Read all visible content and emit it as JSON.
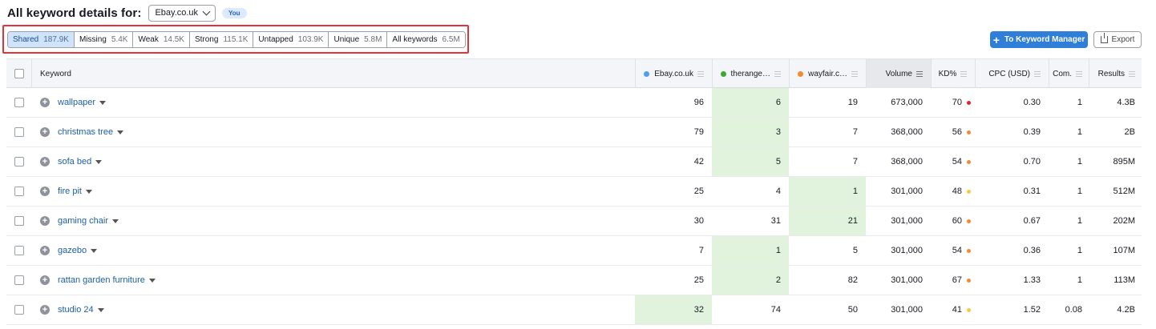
{
  "header": {
    "title": "All keyword details for:",
    "domain_selected": "Ebay.co.uk",
    "you_badge": "You"
  },
  "filters": [
    {
      "label": "Shared",
      "count": "187.9K",
      "active": true
    },
    {
      "label": "Missing",
      "count": "5.4K",
      "active": false
    },
    {
      "label": "Weak",
      "count": "14.5K",
      "active": false
    },
    {
      "label": "Strong",
      "count": "115.1K",
      "active": false
    },
    {
      "label": "Untapped",
      "count": "103.9K",
      "active": false
    },
    {
      "label": "Unique",
      "count": "5.8M",
      "active": false
    },
    {
      "label": "All keywords",
      "count": "6.5M",
      "active": false
    }
  ],
  "toolbar": {
    "keyword_manager_label": "To Keyword Manager",
    "export_label": "Export"
  },
  "columns": {
    "keyword": "Keyword",
    "ebay": "Ebay.co.uk",
    "therange": "therange…",
    "wayfair": "wayfair.c…",
    "volume": "Volume",
    "kd": "KD%",
    "cpc": "CPC (USD)",
    "com": "Com.",
    "results": "Results"
  },
  "colors": {
    "ebay": "#4e9ef0",
    "therange": "#3ea832",
    "wayfair": "#f28a2f",
    "kd_red": "#e0262e",
    "kd_orange": "#f58933",
    "kd_yellow": "#f7c940",
    "highlight_green": "#e1f3dd",
    "active_filter": "#cfe3fb",
    "primary_button": "#2f7ed8"
  },
  "rows": [
    {
      "keyword": "wallpaper",
      "ebay": "96",
      "therange": "6",
      "wayfair": "19",
      "volume": "673,000",
      "kd": "70",
      "kd_level": "red",
      "cpc": "0.30",
      "com": "1",
      "results": "4.3B",
      "best": "therange"
    },
    {
      "keyword": "christmas tree",
      "ebay": "79",
      "therange": "3",
      "wayfair": "7",
      "volume": "368,000",
      "kd": "56",
      "kd_level": "orange",
      "cpc": "0.39",
      "com": "1",
      "results": "2B",
      "best": "therange"
    },
    {
      "keyword": "sofa bed",
      "ebay": "42",
      "therange": "5",
      "wayfair": "7",
      "volume": "368,000",
      "kd": "54",
      "kd_level": "orange",
      "cpc": "0.70",
      "com": "1",
      "results": "895M",
      "best": "therange"
    },
    {
      "keyword": "fire pit",
      "ebay": "25",
      "therange": "4",
      "wayfair": "1",
      "volume": "301,000",
      "kd": "48",
      "kd_level": "yellow",
      "cpc": "0.31",
      "com": "1",
      "results": "512M",
      "best": "wayfair"
    },
    {
      "keyword": "gaming chair",
      "ebay": "30",
      "therange": "31",
      "wayfair": "21",
      "volume": "301,000",
      "kd": "60",
      "kd_level": "orange",
      "cpc": "0.67",
      "com": "1",
      "results": "202M",
      "best": "wayfair"
    },
    {
      "keyword": "gazebo",
      "ebay": "7",
      "therange": "1",
      "wayfair": "5",
      "volume": "301,000",
      "kd": "54",
      "kd_level": "orange",
      "cpc": "0.36",
      "com": "1",
      "results": "107M",
      "best": "therange"
    },
    {
      "keyword": "rattan garden furniture",
      "ebay": "25",
      "therange": "2",
      "wayfair": "82",
      "volume": "301,000",
      "kd": "67",
      "kd_level": "orange",
      "cpc": "1.33",
      "com": "1",
      "results": "113M",
      "best": "therange"
    },
    {
      "keyword": "studio 24",
      "ebay": "32",
      "therange": "74",
      "wayfair": "50",
      "volume": "301,000",
      "kd": "41",
      "kd_level": "yellow",
      "cpc": "1.52",
      "com": "0.08",
      "results": "4.2B",
      "best": "ebay"
    }
  ]
}
